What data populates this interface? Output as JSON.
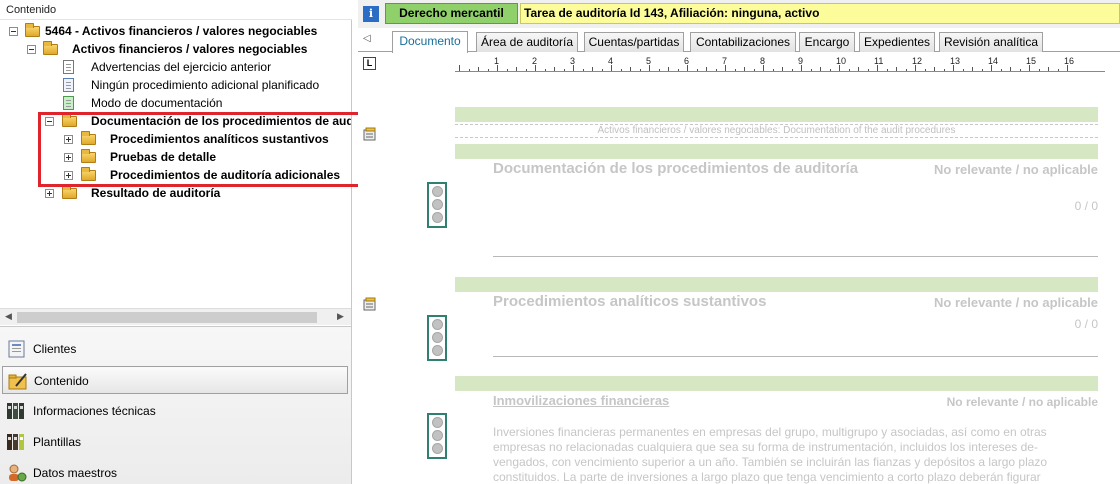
{
  "left_pane": {
    "title": "Contenido",
    "tree": [
      {
        "label": "5464 - Activos financieros / valores negociables",
        "bold": true
      },
      {
        "label": "Activos financieros / valores negociables",
        "bold": true
      },
      {
        "label": "Advertencias del ejercicio anterior",
        "bold": false
      },
      {
        "label": "Ningún procedimiento adicional planificado",
        "bold": false
      },
      {
        "label": "Modo de documentación",
        "bold": false
      },
      {
        "label": "Documentación de los procedimientos de audit",
        "bold": true
      },
      {
        "label": "Procedimientos analíticos sustantivos",
        "bold": true
      },
      {
        "label": "Pruebas de detalle",
        "bold": true
      },
      {
        "label": "Procedimientos de auditoría adicionales",
        "bold": true
      },
      {
        "label": "Resultado de auditoría",
        "bold": true
      }
    ],
    "nav": [
      {
        "label": "Clientes",
        "icon": "clients-icon",
        "active": false
      },
      {
        "label": "Contenido",
        "icon": "folder-pen-icon",
        "active": true
      },
      {
        "label": "Informaciones técnicas",
        "icon": "binders-icon",
        "active": false
      },
      {
        "label": "Plantillas",
        "icon": "binders-dark-icon",
        "active": false
      },
      {
        "label": "Datos maestros",
        "icon": "person-gear-icon",
        "active": false
      }
    ]
  },
  "header": {
    "info_icon_glyph": "i",
    "area": "Derecho mercantil",
    "task": "Tarea de auditoría Id 143, Afiliación: ninguna, activo"
  },
  "tabs": [
    {
      "label": "Documento",
      "active": true
    },
    {
      "label": "Área de auditoría",
      "active": false
    },
    {
      "label": "Cuentas/partidas",
      "active": false
    },
    {
      "label": "Contabilizaciones",
      "active": false
    },
    {
      "label": "Encargo",
      "active": false
    },
    {
      "label": "Expedientes",
      "active": false
    },
    {
      "label": "Revisión analítica",
      "active": false
    }
  ],
  "ruler": {
    "marker": "L",
    "numbers": [
      "1",
      "2",
      "3",
      "4",
      "5",
      "6",
      "7",
      "8",
      "9",
      "10",
      "11",
      "12",
      "13",
      "14",
      "15",
      "16"
    ]
  },
  "document": {
    "banner": "Activos financieros / valores negociables: Documentation of the audit procedures",
    "sections": [
      {
        "title": "Documentación de los procedimientos de auditoría",
        "status": "No relevante / no aplicable",
        "count": "0 / 0"
      },
      {
        "title": "Procedimientos analíticos sustantivos",
        "status": "No relevante / no aplicable",
        "count": "0 / 0"
      }
    ],
    "subsection": {
      "title": "Inmovilizaciones financieras",
      "status": "No relevante / no aplicable"
    },
    "body_lines": [
      "Inversiones financieras permanentes en empresas del grupo, multigrupo y asociadas, así como en otras",
      "empresas no relacionadas cualquiera que sea su forma de instrumentación, incluidos los intereses de-",
      "vengados, con vencimiento superior a un año. También se incluirán las fianzas y depósitos a largo plazo",
      "constituidos. La parte de inversiones a largo plazo que tenga vencimiento a corto plazo deberán figurar"
    ]
  },
  "colors": {
    "area_tag": "#8fd06a",
    "task_tag": "#fcfc9a",
    "green_band": "#d5e8c3",
    "highlight_box": "#e0242c",
    "active_tab_text": "#1a6e98"
  }
}
